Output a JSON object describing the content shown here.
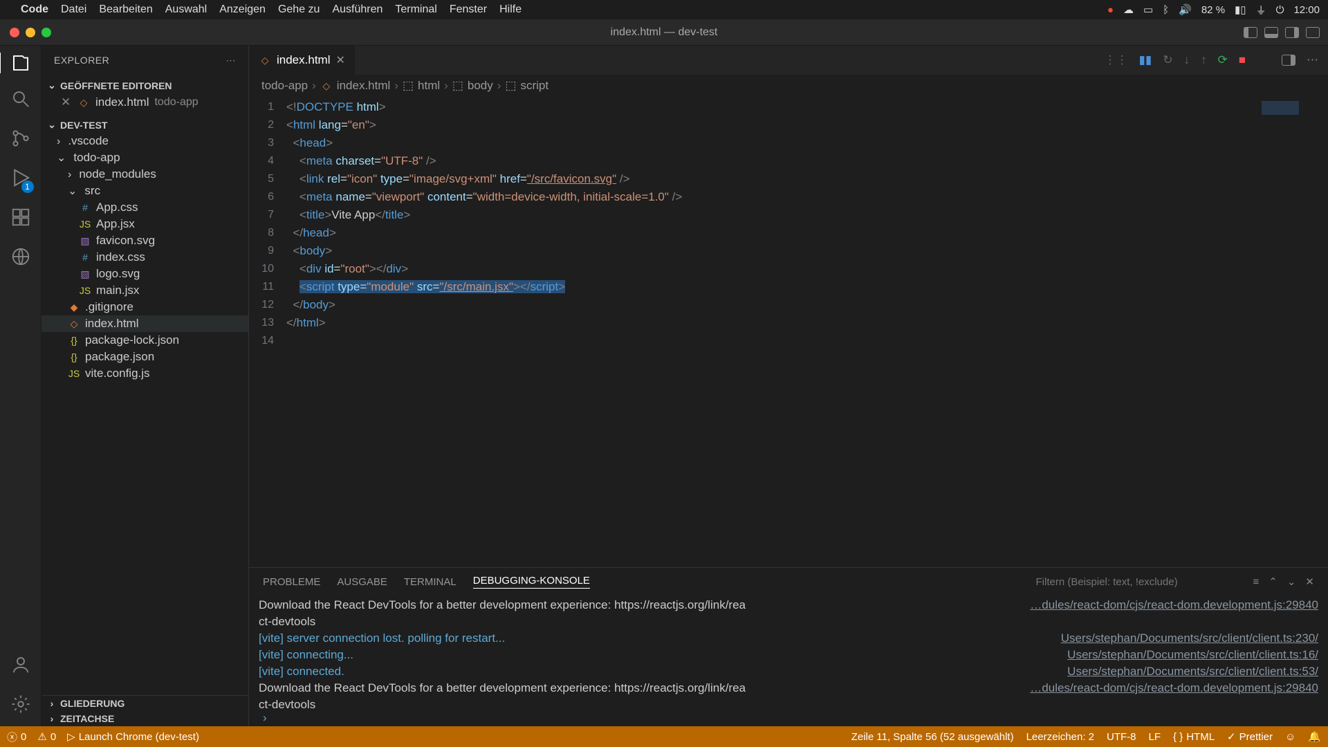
{
  "mac_menu": {
    "app": "Code",
    "items": [
      "Datei",
      "Bearbeiten",
      "Auswahl",
      "Anzeigen",
      "Gehe zu",
      "Ausführen",
      "Terminal",
      "Fenster",
      "Hilfe"
    ],
    "battery": "82 %",
    "time": "12:00"
  },
  "window": {
    "title": "index.html — dev-test"
  },
  "explorer": {
    "title": "EXPLORER",
    "open_editors_label": "GEÖFFNETE EDITOREN",
    "open_editor_file": "index.html",
    "open_editor_folder": "todo-app",
    "workspace": "DEV-TEST",
    "gliederung": "GLIEDERUNG",
    "zeitachse": "ZEITACHSE",
    "tree": [
      {
        "name": ".vscode",
        "type": "folder",
        "indent": 0,
        "open": false
      },
      {
        "name": "todo-app",
        "type": "folder",
        "indent": 0,
        "open": true
      },
      {
        "name": "node_modules",
        "type": "folder",
        "indent": 1,
        "open": false
      },
      {
        "name": "src",
        "type": "folder",
        "indent": 1,
        "open": true
      },
      {
        "name": "App.css",
        "type": "css",
        "indent": 2
      },
      {
        "name": "App.jsx",
        "type": "js",
        "indent": 2
      },
      {
        "name": "favicon.svg",
        "type": "svg",
        "indent": 2
      },
      {
        "name": "index.css",
        "type": "css",
        "indent": 2
      },
      {
        "name": "logo.svg",
        "type": "svg",
        "indent": 2
      },
      {
        "name": "main.jsx",
        "type": "js",
        "indent": 2
      },
      {
        "name": ".gitignore",
        "type": "git",
        "indent": 1
      },
      {
        "name": "index.html",
        "type": "html",
        "indent": 1,
        "selected": true
      },
      {
        "name": "package-lock.json",
        "type": "json",
        "indent": 1
      },
      {
        "name": "package.json",
        "type": "json",
        "indent": 1
      },
      {
        "name": "vite.config.js",
        "type": "js",
        "indent": 1
      }
    ]
  },
  "activity": {
    "debug_badge": "1"
  },
  "tabs": {
    "active_file": "index.html",
    "breadcrumb": [
      "todo-app",
      "index.html",
      "html",
      "body",
      "script"
    ]
  },
  "code": {
    "lines": [
      {
        "n": 1,
        "html": "<span class='tok-ang'>&lt;!</span><span class='tok-tag'>DOCTYPE</span> <span class='tok-attr'>html</span><span class='tok-ang'>&gt;</span>"
      },
      {
        "n": 2,
        "html": "<span class='tok-ang'>&lt;</span><span class='tok-tag'>html</span> <span class='tok-attr'>lang</span>=<span class='tok-str'>\"en\"</span><span class='tok-ang'>&gt;</span>"
      },
      {
        "n": 3,
        "html": "  <span class='tok-ang'>&lt;</span><span class='tok-tag'>head</span><span class='tok-ang'>&gt;</span>"
      },
      {
        "n": 4,
        "html": "    <span class='tok-ang'>&lt;</span><span class='tok-tag'>meta</span> <span class='tok-attr'>charset</span>=<span class='tok-str'>\"UTF-8\"</span> <span class='tok-ang'>/&gt;</span>"
      },
      {
        "n": 5,
        "html": "    <span class='tok-ang'>&lt;</span><span class='tok-tag'>link</span> <span class='tok-attr'>rel</span>=<span class='tok-str'>\"icon\"</span> <span class='tok-attr'>type</span>=<span class='tok-str'>\"image/svg+xml\"</span> <span class='tok-attr'>href</span>=<span class='tok-link'>\"/src/favicon.svg\"</span> <span class='tok-ang'>/&gt;</span>"
      },
      {
        "n": 6,
        "html": "    <span class='tok-ang'>&lt;</span><span class='tok-tag'>meta</span> <span class='tok-attr'>name</span>=<span class='tok-str'>\"viewport\"</span> <span class='tok-attr'>content</span>=<span class='tok-str'>\"width=device-width, initial-scale=1.0\"</span> <span class='tok-ang'>/&gt;</span>"
      },
      {
        "n": 7,
        "html": "    <span class='tok-ang'>&lt;</span><span class='tok-tag'>title</span><span class='tok-ang'>&gt;</span>Vite App<span class='tok-ang'>&lt;/</span><span class='tok-tag'>title</span><span class='tok-ang'>&gt;</span>"
      },
      {
        "n": 8,
        "html": "  <span class='tok-ang'>&lt;/</span><span class='tok-tag'>head</span><span class='tok-ang'>&gt;</span>"
      },
      {
        "n": 9,
        "html": "  <span class='tok-ang'>&lt;</span><span class='tok-tag'>body</span><span class='tok-ang'>&gt;</span>"
      },
      {
        "n": 10,
        "html": "    <span class='tok-ang'>&lt;</span><span class='tok-tag'>div</span> <span class='tok-attr'>id</span>=<span class='tok-str'>\"root\"</span><span class='tok-ang'>&gt;&lt;/</span><span class='tok-tag'>div</span><span class='tok-ang'>&gt;</span>"
      },
      {
        "n": 11,
        "html": "    <span class='sel'><span class='tok-ang'>&lt;</span><span class='tok-tag'>script</span> <span class='tok-attr'>type</span>=<span class='tok-str'>\"module\"</span> <span class='tok-attr'>src</span>=<span class='tok-link'>\"/src/main.jsx\"</span><span class='tok-ang'>&gt;&lt;/</span><span class='tok-tag'>script</span><span class='tok-ang'>&gt;</span></span>"
      },
      {
        "n": 12,
        "html": "  <span class='tok-ang'>&lt;/</span><span class='tok-tag'>body</span><span class='tok-ang'>&gt;</span>"
      },
      {
        "n": 13,
        "html": "<span class='tok-ang'>&lt;/</span><span class='tok-tag'>html</span><span class='tok-ang'>&gt;</span>"
      },
      {
        "n": 14,
        "html": ""
      }
    ]
  },
  "panel": {
    "tabs": {
      "probleme": "PROBLEME",
      "ausgabe": "AUSGABE",
      "terminal": "TERMINAL",
      "debug": "DEBUGGING-KONSOLE"
    },
    "filter_placeholder": "Filtern (Beispiel: text, !exclude)",
    "logs": [
      {
        "msg": "Download the React DevTools for a better development experience: https://reactjs.org/link/rea",
        "src": "…dules/react-dom/cjs/react-dom.development.js:29840",
        "cls": ""
      },
      {
        "msg": "ct-devtools",
        "src": "",
        "cls": ""
      },
      {
        "msg": "[vite] server connection lost. polling for restart...",
        "src": "Users/stephan/Documents/src/client/client.ts:230/",
        "cls": "info"
      },
      {
        "msg": "[vite] connecting...",
        "src": "Users/stephan/Documents/src/client/client.ts:16/",
        "cls": "info"
      },
      {
        "msg": "[vite] connected.",
        "src": "Users/stephan/Documents/src/client/client.ts:53/",
        "cls": "info"
      },
      {
        "msg": "Download the React DevTools for a better development experience: https://reactjs.org/link/rea",
        "src": "…dules/react-dom/cjs/react-dom.development.js:29840",
        "cls": ""
      },
      {
        "msg": "ct-devtools",
        "src": "",
        "cls": ""
      }
    ],
    "prompt": "›"
  },
  "status": {
    "errors": "0",
    "warnings": "0",
    "launch": "Launch Chrome (dev-test)",
    "position": "Zeile 11, Spalte 56 (52 ausgewählt)",
    "spaces": "Leerzeichen: 2",
    "encoding": "UTF-8",
    "eol": "LF",
    "lang": "HTML",
    "prettier": "Prettier"
  }
}
